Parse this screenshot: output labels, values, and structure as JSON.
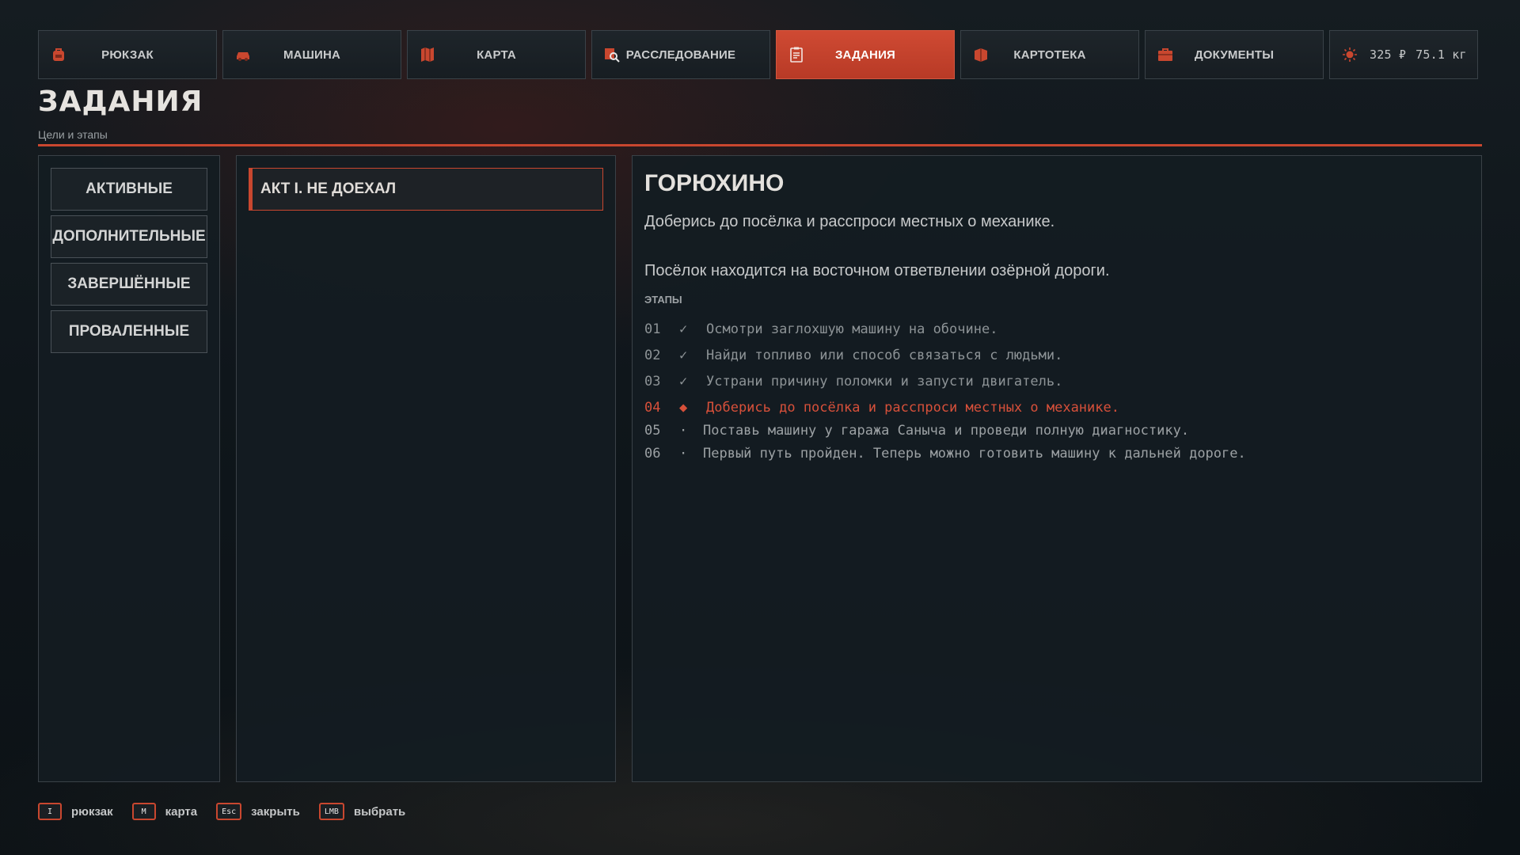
{
  "tabs": [
    {
      "label": "РЮКЗАК",
      "icon": "backpack-icon"
    },
    {
      "label": "МАШИНА",
      "icon": "car-icon"
    },
    {
      "label": "КАРТА",
      "icon": "map-icon"
    },
    {
      "label": "РАССЛЕДОВАНИЕ",
      "icon": "magnifier-icon"
    },
    {
      "label": "ЗАДАНИЯ",
      "icon": "clipboard-icon",
      "active": true
    },
    {
      "label": "КАРТОТЕКА",
      "icon": "file-box-icon"
    },
    {
      "label": "ДОКУМЕНТЫ",
      "icon": "briefcase-icon"
    }
  ],
  "status": {
    "icon": "sun-icon",
    "money": "325 ₽",
    "weight": "75.1 кг"
  },
  "header": {
    "title": "ЗАДАНИЯ",
    "subtitle": "Цели и этапы"
  },
  "filters": [
    {
      "label": "АКТИВНЫЕ"
    },
    {
      "label": "ДОПОЛНИТЕЛЬНЫЕ"
    },
    {
      "label": "ЗАВЕРШЁННЫЕ"
    },
    {
      "label": "ПРОВАЛЕННЫЕ"
    }
  ],
  "quests": [
    {
      "label": "АКТ I. НЕ ДОЕХАЛ",
      "selected": true
    }
  ],
  "detail": {
    "title": "ГОРЮХИНО",
    "objective": "Доберись до посёлка и расспроси местных о механике.",
    "note": "Посёлок находится на восточном ответвлении озёрной дороги.",
    "stages_label": "ЭТАПЫ",
    "stages": [
      {
        "num": "01",
        "mark": "✓",
        "text": "Осмотри заглохшую машину на обочине.",
        "state": "done"
      },
      {
        "num": "02",
        "mark": "✓",
        "text": "Найди топливо или способ связаться с людьми.",
        "state": "done"
      },
      {
        "num": "03",
        "mark": "✓",
        "text": "Устрани причину поломки и запусти двигатель.",
        "state": "done"
      },
      {
        "num": "04",
        "mark": "◆",
        "text": "Доберись до посёлка и расспроси местных о механике.",
        "state": "current"
      },
      {
        "num": "05",
        "mark": "·",
        "text": "Поставь машину у гаража Саныча и проведи полную диагностику.",
        "state": "pending"
      },
      {
        "num": "06",
        "mark": "·",
        "text": "Первый путь пройден. Теперь можно готовить машину к дальней дороге.",
        "state": "pending"
      }
    ]
  },
  "footer": [
    {
      "key": "I",
      "label": "рюкзак"
    },
    {
      "key": "M",
      "label": "карта"
    },
    {
      "key": "Esc",
      "label": "закрыть"
    },
    {
      "key": "LMB",
      "label": "выбрать"
    }
  ],
  "colors": {
    "accent": "#c9472f",
    "background": "#0e1418",
    "panel": "#141c22"
  }
}
